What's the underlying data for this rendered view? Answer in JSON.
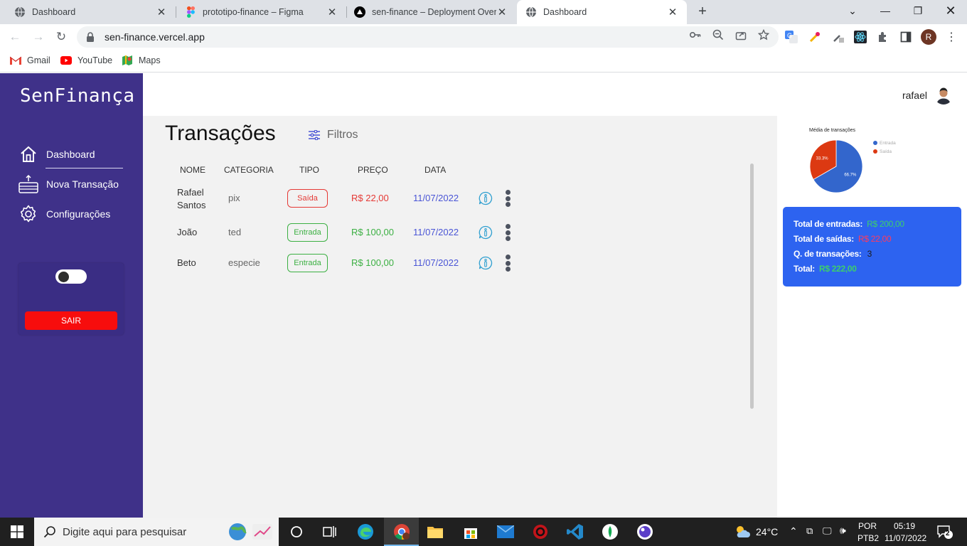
{
  "browser": {
    "tabs": [
      {
        "title": "Dashboard",
        "icon": "globe-icon"
      },
      {
        "title": "prototipo-finance – Figma",
        "icon": "figma-icon"
      },
      {
        "title": "sen-finance – Deployment Overvi",
        "icon": "vercel-icon"
      },
      {
        "title": "Dashboard",
        "icon": "globe-icon",
        "active": true
      }
    ],
    "url": "sen-finance.vercel.app",
    "bookmarks": [
      {
        "label": "Gmail",
        "icon": "gmail-icon"
      },
      {
        "label": "YouTube",
        "icon": "youtube-icon"
      },
      {
        "label": "Maps",
        "icon": "maps-icon"
      }
    ],
    "profile_initial": "R"
  },
  "app": {
    "logo": "SenFinança",
    "nav": [
      {
        "label": "Dashboard",
        "icon": "home-icon",
        "active": true
      },
      {
        "label": "Nova Transação",
        "icon": "new-transaction-icon"
      },
      {
        "label": "Configurações",
        "icon": "gear-icon"
      }
    ],
    "logout_label": "SAIR",
    "user_name": "rafael",
    "page_title": "Transações",
    "filters_label": "Filtros",
    "table": {
      "headers": [
        "NOME",
        "CATEGORIA",
        "TIPO",
        "PREÇO",
        "DATA"
      ],
      "rows": [
        {
          "name": "Rafael Santos",
          "category": "pix",
          "type": "Saída",
          "price": "R$ 22,00",
          "date": "11/07/2022"
        },
        {
          "name": "João",
          "category": "ted",
          "type": "Entrada",
          "price": "R$ 100,00",
          "date": "11/07/2022"
        },
        {
          "name": "Beto",
          "category": "especie",
          "type": "Entrada",
          "price": "R$ 100,00",
          "date": "11/07/2022"
        }
      ]
    },
    "summary": {
      "entradas_label": "Total de entradas:",
      "entradas_value": "R$ 200,00",
      "saidas_label": "Total de saídas:",
      "saidas_value": "R$ 22,00",
      "count_label": "Q. de transações:",
      "count_value": "3",
      "total_label": "Total:",
      "total_value": "R$ 222,00"
    },
    "colors": {
      "sidebar": "#3f3189",
      "income": "#3cb043",
      "expense": "#e53935",
      "date": "#4a55d6",
      "summary_bg": "#2d63f0"
    }
  },
  "chart_data": {
    "type": "pie",
    "title": "Média de transações",
    "categories": [
      "Entrada",
      "Saída"
    ],
    "values": [
      66.7,
      33.3
    ],
    "labels": [
      "66.7%",
      "33.3%"
    ],
    "colors": [
      "#3366cc",
      "#dc3912"
    ],
    "legend": "right"
  },
  "taskbar": {
    "search_placeholder": "Digite aqui para pesquisar",
    "temperature": "24°C",
    "language": "POR",
    "keyboard": "PTB2",
    "time": "05:19",
    "date": "11/07/2022",
    "notifications": "2"
  }
}
